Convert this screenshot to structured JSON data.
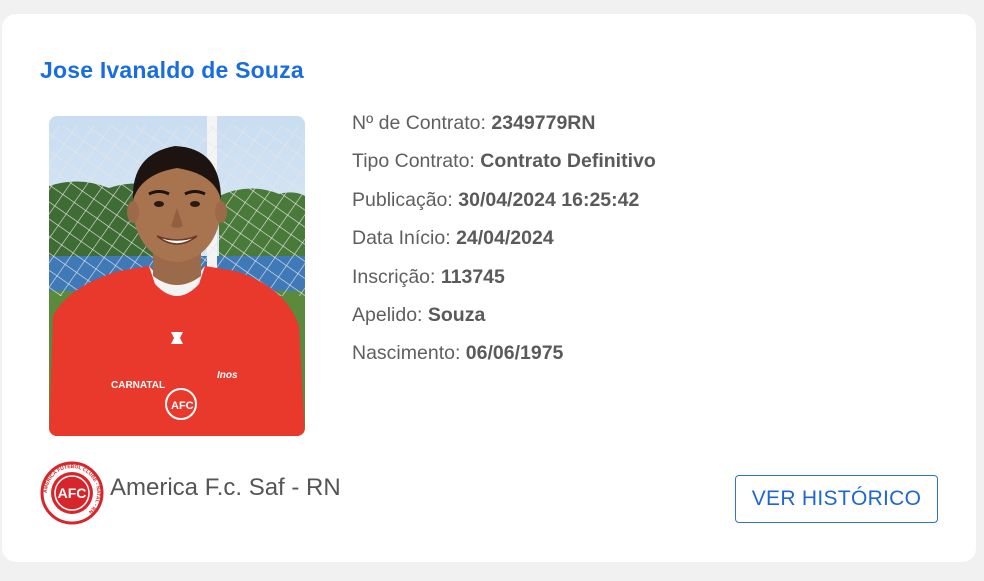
{
  "player": {
    "name": "Jose Ivanaldo de Souza",
    "photo_icon": "player-photo"
  },
  "details": [
    {
      "label": "Nº de Contrato:",
      "value": "2349779RN"
    },
    {
      "label": "Tipo Contrato:",
      "value": "Contrato Definitivo"
    },
    {
      "label": "Publicação:",
      "value": "30/04/2024 16:25:42"
    },
    {
      "label": "Data Início:",
      "value": "24/04/2024"
    },
    {
      "label": "Inscrição:",
      "value": "113745"
    },
    {
      "label": "Apelido:",
      "value": "Souza"
    },
    {
      "label": "Nascimento:",
      "value": "06/06/1975"
    }
  ],
  "club": {
    "name": "America F.c. Saf - RN",
    "logo_icon": "club-crest-icon",
    "logo_text": "AFC",
    "logo_ring_text": "AMERICA FUTEBOL CLUBE - NATAL - RN"
  },
  "actions": {
    "history_label": "VER HISTÓRICO"
  },
  "colors": {
    "name_blue": "#1a6de0",
    "button_blue": "#1e66d0",
    "club_red": "#d7262b",
    "background": "#f1f1f1"
  }
}
